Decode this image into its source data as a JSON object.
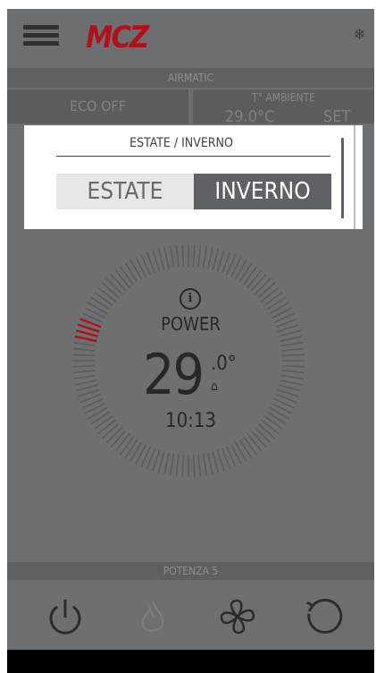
{
  "header": {
    "logo_text": "MCZ",
    "brand_color": "#b0121b",
    "menu_icon": "hamburger-icon",
    "snow_icon": "snowflake-icon"
  },
  "status": {
    "airmatic_label": "AIRMATIC",
    "eco_label": "ECO OFF",
    "ambient_label": "T° AMBIENTE",
    "ambient_value": "29.0°C",
    "set_label": "SET"
  },
  "dialog": {
    "title": "ESTATE / INVERNO",
    "option_left": "ESTATE",
    "option_right": "INVERNO",
    "selected": "INVERNO",
    "selected_color": "#5e6165"
  },
  "dial": {
    "info_icon": "info-icon",
    "mode_label": "POWER",
    "temp_main": "29",
    "temp_decimal": ".0°",
    "home_icon": "home-icon",
    "time": "10:13",
    "active_ticks_color": "#b0121b"
  },
  "footer": {
    "power_level_label": "POTENZA 5",
    "icons": [
      "power-icon",
      "flame-icon",
      "fan-icon",
      "refresh-icon"
    ]
  }
}
